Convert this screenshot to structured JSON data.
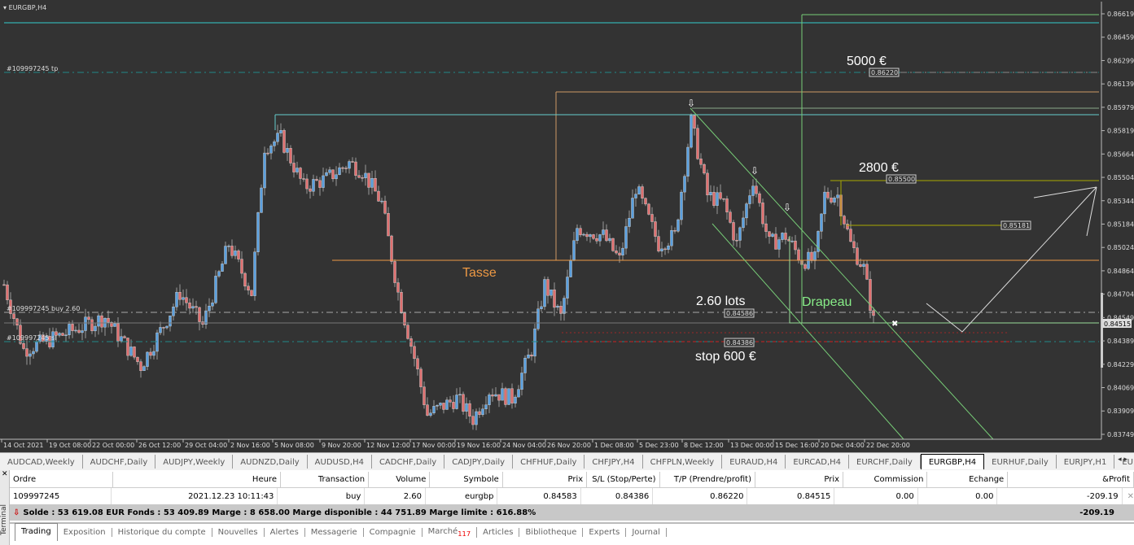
{
  "window": {
    "title": "EURGBP,H4"
  },
  "chart": {
    "price_axis": [
      "0.86619",
      "0.86459",
      "0.86299",
      "0.86139",
      "0.85979",
      "0.85819",
      "0.85664",
      "0.85504",
      "0.85344",
      "0.85184",
      "0.85024",
      "0.84864",
      "0.84704",
      "0.84549",
      "0.84389",
      "0.84229",
      "0.84069",
      "0.83909",
      "0.83749"
    ],
    "current_price": "0.84515",
    "time_axis": [
      "14 Oct 2021",
      "19 Oct 08:00",
      "22 Oct 00:00",
      "26 Oct 12:00",
      "29 Oct 04:00",
      "2 Nov 16:00",
      "5 Nov 08:00",
      "9 Nov 20:00",
      "12 Nov 12:00",
      "17 Nov 00:00",
      "19 Nov 16:00",
      "24 Nov 04:00",
      "26 Nov 20:00",
      "1 Dec 08:00",
      "5 Dec 23:00",
      "8 Dec 12:00",
      "13 Dec 00:00",
      "15 Dec 16:00",
      "20 Dec 04:00",
      "22 Dec 20:00"
    ],
    "order_labels": {
      "tp": "#109997245 tp",
      "buy": "#109997245 buy 2.60",
      "sl": "#109997245 sl"
    },
    "annotations": {
      "target1": "5000 €",
      "target1_price": "0.86220",
      "target2": "2800 €",
      "target2_price": "0.85500",
      "mid_price": "0.85181",
      "lots": "2.60 lots",
      "entry_price": "0.84586",
      "stop": "stop 600 €",
      "stop_price": "0.84386",
      "cup": "Tasse",
      "flag": "Drapeau"
    },
    "colors": {
      "bull": "#5aa0e0",
      "bear": "#e07070",
      "bg": "#333333"
    }
  },
  "chart_data": {
    "type": "candlestick",
    "symbol": "EURGBP",
    "timeframe": "H4",
    "ylim": [
      0.83749,
      0.86619
    ],
    "waypoints": [
      [
        0,
        0.84771
      ],
      [
        6,
        0.84327
      ],
      [
        19,
        0.84438
      ],
      [
        31,
        0.84549
      ],
      [
        42,
        0.84216
      ],
      [
        49,
        0.84493
      ],
      [
        54,
        0.84715
      ],
      [
        61,
        0.84493
      ],
      [
        69,
        0.85048
      ],
      [
        76,
        0.84715
      ],
      [
        80,
        0.85714
      ],
      [
        85,
        0.8577
      ],
      [
        92,
        0.85437
      ],
      [
        99,
        0.85492
      ],
      [
        106,
        0.85603
      ],
      [
        110,
        0.85548
      ],
      [
        116,
        0.85326
      ],
      [
        121,
        0.84715
      ],
      [
        126,
        0.84271
      ],
      [
        130,
        0.83883
      ],
      [
        139,
        0.83994
      ],
      [
        144,
        0.83855
      ],
      [
        149,
        0.84049
      ],
      [
        156,
        0.83994
      ],
      [
        162,
        0.84327
      ],
      [
        166,
        0.84771
      ],
      [
        171,
        0.84549
      ],
      [
        176,
        0.85159
      ],
      [
        184,
        0.85104
      ],
      [
        189,
        0.84937
      ],
      [
        194,
        0.85437
      ],
      [
        201,
        0.85048
      ],
      [
        206,
        0.85104
      ],
      [
        211,
        0.85881
      ],
      [
        216,
        0.85381
      ],
      [
        221,
        0.85326
      ],
      [
        225,
        0.85048
      ],
      [
        230,
        0.85492
      ],
      [
        235,
        0.85048
      ],
      [
        240,
        0.85104
      ],
      [
        245,
        0.84937
      ],
      [
        249,
        0.84937
      ],
      [
        252,
        0.85381
      ],
      [
        256,
        0.85381
      ],
      [
        260,
        0.85048
      ],
      [
        264,
        0.84882
      ],
      [
        267,
        0.84521
      ]
    ]
  },
  "tabs": [
    "AUDCAD,Weekly",
    "AUDCHF,Daily",
    "AUDJPY,Weekly",
    "AUDNZD,Daily",
    "AUDUSD,H4",
    "CADCHF,Daily",
    "CADJPY,Daily",
    "CHFHUF,Daily",
    "CHFJPY,H4",
    "CHFPLN,Weekly",
    "EURAUD,H4",
    "EURCAD,H4",
    "EURCHF,Daily",
    "EURGBP,H4",
    "EURHUF,Daily",
    "EURJPY,H1",
    "EURNO"
  ],
  "active_tab": 13,
  "terminal": {
    "label": "Terminal",
    "headers": [
      "Ordre",
      "Heure",
      "Transaction",
      "Volume",
      "Symbole",
      "Prix",
      "S/L (Stop/Perte)",
      "T/P (Prendre/profit)",
      "Prix",
      "Commission",
      "Echange",
      "&Profit"
    ],
    "order": [
      "109997245",
      "2021.12.23 10:11:43",
      "buy",
      "2.60",
      "eurgbp",
      "0.84583",
      "0.84386",
      "0.86220",
      "0.84515",
      "0.00",
      "0.00",
      "-209.19"
    ],
    "summary": "Solde : 53 619.08 EUR  Fonds : 53 409.89  Marge : 8 658.00  Marge disponible : 44 751.89  Marge limite : 616.88%",
    "summary_profit": "-209.19",
    "bottom_tabs": [
      "Trading",
      "Exposition",
      "Historique du compte",
      "Nouvelles",
      "Alertes",
      "Messagerie",
      "Compagnie",
      "Marché",
      "Articles",
      "Bibliotheque",
      "Experts",
      "Journal"
    ],
    "market_badge": "117"
  }
}
